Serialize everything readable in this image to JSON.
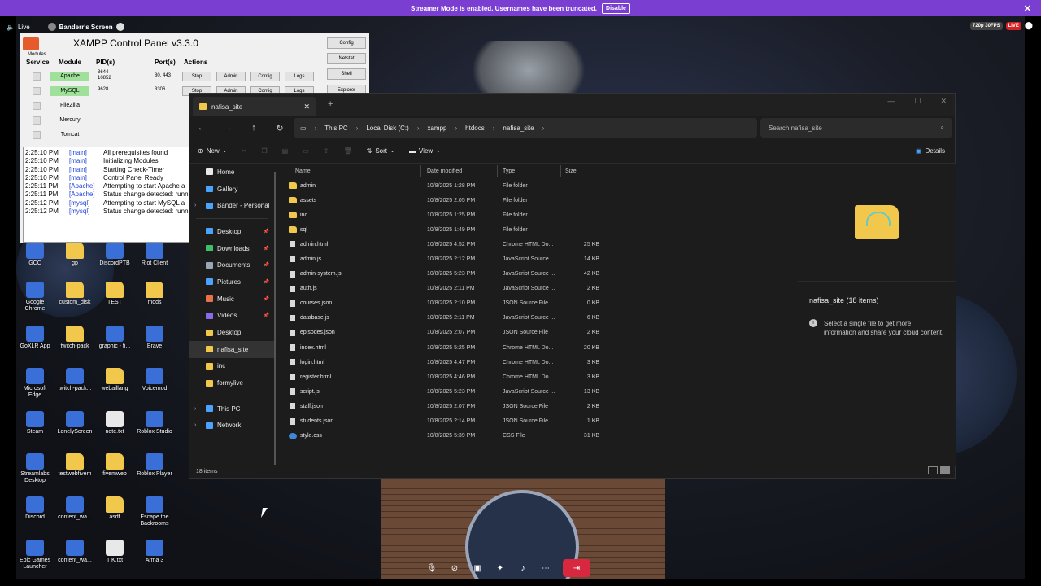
{
  "banner": {
    "text": "Streamer Mode is enabled. Usernames have been truncated.",
    "disable": "Disable"
  },
  "stream": {
    "live": "Live",
    "screen_name": "Banderr's Screen",
    "quality": "720p 30FPS",
    "live_badge": "LIVE"
  },
  "xampp": {
    "title": "XAMPP Control Panel v3.3.0",
    "modules_label": "Modules",
    "headers": {
      "service": "Service",
      "module": "Module",
      "pids": "PID(s)",
      "ports": "Port(s)",
      "actions": "Actions"
    },
    "side_buttons": [
      "Config",
      "Netstat",
      "Shell",
      "Explorer"
    ],
    "modules": [
      {
        "name": "Apache",
        "pid": "3644\n10852",
        "port": "80, 443",
        "action": "Stop",
        "admin": "Admin",
        "config": "Config",
        "logs": "Logs"
      },
      {
        "name": "MySQL",
        "pid": "9628",
        "port": "3306",
        "action": "Stop",
        "admin": "Admin",
        "config": "Config",
        "logs": "Logs"
      },
      {
        "name": "FileZilla"
      },
      {
        "name": "Mercury"
      },
      {
        "name": "Tomcat"
      }
    ],
    "log": [
      {
        "time": "2:25:10 PM",
        "mod": "[main]",
        "msg": "All prerequisites found"
      },
      {
        "time": "2:25:10 PM",
        "mod": "[main]",
        "msg": "Initializing Modules"
      },
      {
        "time": "2:25:10 PM",
        "mod": "[main]",
        "msg": "Starting Check-Timer"
      },
      {
        "time": "2:25:10 PM",
        "mod": "[main]",
        "msg": "Control Panel Ready"
      },
      {
        "time": "2:25:11 PM",
        "mod": "[Apache]",
        "msg": "Attempting to start Apache a"
      },
      {
        "time": "2:25:11 PM",
        "mod": "[Apache]",
        "msg": "Status change detected: runn"
      },
      {
        "time": "2:25:12 PM",
        "mod": "[mysql]",
        "msg": "Attempting to start MySQL a"
      },
      {
        "time": "2:25:12 PM",
        "mod": "[mysql]",
        "msg": "Status change detected: runn"
      }
    ]
  },
  "desktop": [
    {
      "label": "GCC",
      "kind": "app"
    },
    {
      "label": "gp",
      "kind": "folder"
    },
    {
      "label": "DiscordPTB",
      "kind": "app"
    },
    {
      "label": "Riot Client",
      "kind": "app"
    },
    {
      "label": "Google Chrome",
      "kind": "app"
    },
    {
      "label": "custom_disk",
      "kind": "folder"
    },
    {
      "label": "TEST",
      "kind": "folder"
    },
    {
      "label": "mods",
      "kind": "folder"
    },
    {
      "label": "GoXLR App",
      "kind": "app"
    },
    {
      "label": "twitch-pack",
      "kind": "folder"
    },
    {
      "label": "graphic - fi...",
      "kind": "app"
    },
    {
      "label": "Brave",
      "kind": "app"
    },
    {
      "label": "Microsoft Edge",
      "kind": "app"
    },
    {
      "label": "twitch-pack...",
      "kind": "app"
    },
    {
      "label": "webaillang",
      "kind": "folder"
    },
    {
      "label": "Voicemod",
      "kind": "app"
    },
    {
      "label": "Steam",
      "kind": "app"
    },
    {
      "label": "LonelyScreen",
      "kind": "app"
    },
    {
      "label": "note.txt",
      "kind": "file"
    },
    {
      "label": "Roblox Studio",
      "kind": "app"
    },
    {
      "label": "Streamlabs Desktop",
      "kind": "app"
    },
    {
      "label": "testwebfivem",
      "kind": "folder"
    },
    {
      "label": "fivemweb",
      "kind": "folder"
    },
    {
      "label": "Roblox Player",
      "kind": "app"
    },
    {
      "label": "Discord",
      "kind": "app"
    },
    {
      "label": "content_wa...",
      "kind": "app"
    },
    {
      "label": "asdf",
      "kind": "folder"
    },
    {
      "label": "Escape the Backrooms",
      "kind": "app"
    },
    {
      "label": "Epic Games Launcher",
      "kind": "app"
    },
    {
      "label": "content_wa...",
      "kind": "app"
    },
    {
      "label": "T K.txt",
      "kind": "file"
    },
    {
      "label": "Arma 3",
      "kind": "app"
    }
  ],
  "explorer": {
    "tab_title": "nafisa_site",
    "breadcrumb": [
      "This PC",
      "Local Disk (C:)",
      "xampp",
      "htdocs",
      "nafisa_site"
    ],
    "search_placeholder": "Search nafisa_site",
    "cmd": {
      "new": "New",
      "sort": "Sort",
      "view": "View",
      "details": "Details"
    },
    "nav": [
      {
        "label": "Home",
        "icon": "home-icon",
        "color": "#e8e8e8"
      },
      {
        "label": "Gallery",
        "icon": "gallery-icon",
        "color": "#4aa3ff"
      },
      {
        "label": "Bander - Personal",
        "icon": "cloud-icon",
        "color": "#4aa3ff",
        "expand": true
      },
      {
        "sep": true
      },
      {
        "label": "Desktop",
        "icon": "desktop-icon",
        "color": "#4aa3ff",
        "pin": true
      },
      {
        "label": "Downloads",
        "icon": "download-icon",
        "color": "#3fbf6a",
        "pin": true
      },
      {
        "label": "Documents",
        "icon": "documents-icon",
        "color": "#9aa6b5",
        "pin": true
      },
      {
        "label": "Pictures",
        "icon": "pictures-icon",
        "color": "#4aa3ff",
        "pin": true
      },
      {
        "label": "Music",
        "icon": "music-icon",
        "color": "#e8714a",
        "pin": true
      },
      {
        "label": "Videos",
        "icon": "videos-icon",
        "color": "#8a6ae8",
        "pin": true
      },
      {
        "label": "Desktop",
        "icon": "folder-icon",
        "color": "#f1c84b"
      },
      {
        "label": "nafisa_site",
        "icon": "folder-icon",
        "color": "#f1c84b",
        "selected": true
      },
      {
        "label": "inc",
        "icon": "folder-icon",
        "color": "#f1c84b"
      },
      {
        "label": "formylive",
        "icon": "folder-icon",
        "color": "#f1c84b"
      },
      {
        "sep": true
      },
      {
        "label": "This PC",
        "icon": "pc-icon",
        "color": "#4aa3ff",
        "expand": true
      },
      {
        "label": "Network",
        "icon": "network-icon",
        "color": "#4aa3ff",
        "expand": true
      }
    ],
    "columns": {
      "name": "Name",
      "date": "Date modified",
      "type": "Type",
      "size": "Size"
    },
    "files": [
      {
        "name": "admin",
        "date": "10/8/2025 1:28 PM",
        "type": "File folder",
        "size": "",
        "kind": "folder"
      },
      {
        "name": "assets",
        "date": "10/8/2025 2:05 PM",
        "type": "File folder",
        "size": "",
        "kind": "folder"
      },
      {
        "name": "inc",
        "date": "10/8/2025 1:25 PM",
        "type": "File folder",
        "size": "",
        "kind": "folder"
      },
      {
        "name": "sql",
        "date": "10/8/2025 1:49 PM",
        "type": "File folder",
        "size": "",
        "kind": "folder"
      },
      {
        "name": "admin.html",
        "date": "10/8/2025 4:52 PM",
        "type": "Chrome HTML Do...",
        "size": "25 KB",
        "kind": "doc"
      },
      {
        "name": "admin.js",
        "date": "10/8/2025 2:12 PM",
        "type": "JavaScript Source ...",
        "size": "14 KB",
        "kind": "doc"
      },
      {
        "name": "admin-system.js",
        "date": "10/8/2025 5:23 PM",
        "type": "JavaScript Source ...",
        "size": "42 KB",
        "kind": "doc"
      },
      {
        "name": "auth.js",
        "date": "10/8/2025 2:11 PM",
        "type": "JavaScript Source ...",
        "size": "2 KB",
        "kind": "doc"
      },
      {
        "name": "courses.json",
        "date": "10/8/2025 2:10 PM",
        "type": "JSON Source File",
        "size": "0 KB",
        "kind": "doc"
      },
      {
        "name": "database.js",
        "date": "10/8/2025 2:11 PM",
        "type": "JavaScript Source ...",
        "size": "6 KB",
        "kind": "doc"
      },
      {
        "name": "episodes.json",
        "date": "10/8/2025 2:07 PM",
        "type": "JSON Source File",
        "size": "2 KB",
        "kind": "doc"
      },
      {
        "name": "index.html",
        "date": "10/8/2025 5:25 PM",
        "type": "Chrome HTML Do...",
        "size": "20 KB",
        "kind": "doc"
      },
      {
        "name": "login.html",
        "date": "10/8/2025 4:47 PM",
        "type": "Chrome HTML Do...",
        "size": "3 KB",
        "kind": "doc"
      },
      {
        "name": "register.html",
        "date": "10/8/2025 4:46 PM",
        "type": "Chrome HTML Do...",
        "size": "3 KB",
        "kind": "doc"
      },
      {
        "name": "script.js",
        "date": "10/8/2025 5:23 PM",
        "type": "JavaScript Source ...",
        "size": "13 KB",
        "kind": "doc"
      },
      {
        "name": "staff.json",
        "date": "10/8/2025 2:07 PM",
        "type": "JSON Source File",
        "size": "2 KB",
        "kind": "doc"
      },
      {
        "name": "students.json",
        "date": "10/8/2025 2:14 PM",
        "type": "JSON Source File",
        "size": "1 KB",
        "kind": "doc"
      },
      {
        "name": "style.css",
        "date": "10/8/2025 5:39 PM",
        "type": "CSS File",
        "size": "31 KB",
        "kind": "css"
      }
    ],
    "detail_title": "nafisa_site (18 items)",
    "detail_info": "Select a single file to get more information and share your cloud content.",
    "status": "18 items  |"
  }
}
